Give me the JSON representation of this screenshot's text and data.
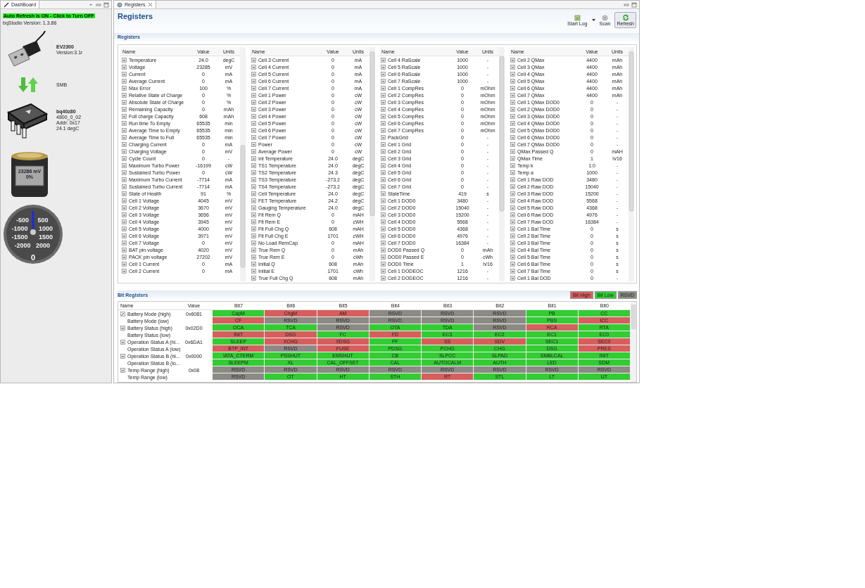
{
  "dashboard": {
    "tab": "DashBoard",
    "auto_refresh": "Auto Refresh is ON - Click to Turn OFF",
    "version": "bqStudio Version:  1.3.86",
    "adapter": {
      "name": "EV2300",
      "version": "Version:3.1r"
    },
    "bus": "SMB",
    "device": {
      "name": "bq40z80",
      "lines": [
        "4800_0_02",
        "Addr: 0x17",
        "24.1 degC"
      ]
    },
    "battery": {
      "voltage": "23286 mV",
      "charge": "0%"
    },
    "gauge": {
      "labels": [
        "-500",
        "500",
        "-1000",
        "1000",
        "-1500",
        "1500",
        "-2000",
        "2000"
      ],
      "reading": "0"
    }
  },
  "registers_view": {
    "tab": "Registers",
    "title": "Registers",
    "toolbar": [
      {
        "label": "Start Log",
        "kind": "log"
      },
      {
        "label": "Scan",
        "kind": "scan"
      },
      {
        "label": "Refresh",
        "kind": "refresh"
      }
    ],
    "section": "Registers",
    "tables": [
      {
        "columns": [
          "Name",
          "Value",
          "Units"
        ],
        "rows": [
          [
            "Temperature",
            "24.0",
            "degC"
          ],
          [
            "Voltage",
            "23285",
            "mV"
          ],
          [
            "Current",
            "0",
            "mA"
          ],
          [
            "Average Current",
            "0",
            "mA"
          ],
          [
            "Max Error",
            "100",
            "%"
          ],
          [
            "Relative State of Charge",
            "0",
            "%"
          ],
          [
            "Absolute State of Charge",
            "0",
            "%"
          ],
          [
            "Remaining Capacity",
            "0",
            "mAh"
          ],
          [
            "Full charge Capacity",
            "608",
            "mAh"
          ],
          [
            "Run time To Empty",
            "65535",
            "min"
          ],
          [
            "Average Time to Empty",
            "65535",
            "min"
          ],
          [
            "Average Time to Full",
            "65535",
            "min"
          ],
          [
            "Charging Current",
            "0",
            "mA"
          ],
          [
            "Charging Voltage",
            "0",
            "mV"
          ],
          [
            "Cycle Count",
            "0",
            "-"
          ],
          [
            "Maximum Turbo Power",
            "-16199",
            "cW"
          ],
          [
            "Sustained Turbo Power",
            "0",
            "cW"
          ],
          [
            "Maximum Turbo Current",
            "-7714",
            "mA"
          ],
          [
            "Sustained Turbo Current",
            "-7714",
            "mA"
          ],
          [
            "State of Health",
            "91",
            "%"
          ],
          [
            "Cell 1 Voltage",
            "4045",
            "mV"
          ],
          [
            "Cell 2 Voltage",
            "3670",
            "mV"
          ],
          [
            "Cell 3 Voltage",
            "3656",
            "mV"
          ],
          [
            "Cell 4 Voltage",
            "3945",
            "mV"
          ],
          [
            "Cell 5 Voltage",
            "4000",
            "mV"
          ],
          [
            "Cell 6 Voltage",
            "3971",
            "mV"
          ],
          [
            "Cell 7 Voltage",
            "0",
            "mV"
          ],
          [
            "BAT pin voltage",
            "4020",
            "mV"
          ],
          [
            "PACK pin voltage",
            "27202",
            "mV"
          ],
          [
            "Cell 1 Current",
            "0",
            "mA"
          ],
          [
            "Cell 2 Current",
            "0",
            "mA"
          ]
        ]
      },
      {
        "columns": [
          "Name",
          "Value",
          "Units"
        ],
        "rows": [
          [
            "Cell 3 Current",
            "0",
            "mA"
          ],
          [
            "Cell 4 Current",
            "0",
            "mA"
          ],
          [
            "Cell 5 Current",
            "0",
            "mA"
          ],
          [
            "Cell 6 Current",
            "0",
            "mA"
          ],
          [
            "Cell 7 Current",
            "0",
            "mA"
          ],
          [
            "Cell 1 Power",
            "0",
            "cW"
          ],
          [
            "Cell 2 Power",
            "0",
            "cW"
          ],
          [
            "Cell 3 Power",
            "0",
            "cW"
          ],
          [
            "Cell 4 Power",
            "0",
            "cW"
          ],
          [
            "Cell 5 Power",
            "0",
            "cW"
          ],
          [
            "Cell 6 Power",
            "0",
            "cW"
          ],
          [
            "Cell 7 Power",
            "0",
            "cW"
          ],
          [
            "Power",
            "0",
            "cW"
          ],
          [
            "Average Power",
            "0",
            "cW"
          ],
          [
            "Int Temperature",
            "24.0",
            "degC"
          ],
          [
            "TS1 Temperature",
            "24.0",
            "degC"
          ],
          [
            "TS2 Temperature",
            "24.3",
            "degC"
          ],
          [
            "TS3 Temperature",
            "-273.2",
            "degC"
          ],
          [
            "TS4 Temperature",
            "-273.2",
            "degC"
          ],
          [
            "Cell Temperature",
            "24.0",
            "degC"
          ],
          [
            "FET Temperature",
            "24.2",
            "degC"
          ],
          [
            "Gauging Temperature",
            "24.0",
            "degC"
          ],
          [
            "Flt Rem Q",
            "0",
            "mAH"
          ],
          [
            "Flt Rem E",
            "0",
            "cWH"
          ],
          [
            "Flt Full Chg Q",
            "608",
            "mAH"
          ],
          [
            "Flt Full Chg E",
            "1701",
            "cWH"
          ],
          [
            "No Load RemCap",
            "0",
            "mAH"
          ],
          [
            "True Rem Q",
            "0",
            "mAh"
          ],
          [
            "True Rem E",
            "0",
            "cWh"
          ],
          [
            "Initial Q",
            "608",
            "mAh"
          ],
          [
            "Initial E",
            "1701",
            "cWh"
          ],
          [
            "True Full Chg Q",
            "608",
            "mAh"
          ]
        ]
      },
      {
        "columns": [
          "Name",
          "Value",
          "Units"
        ],
        "rows": [
          [
            "Cell 4 RaScale",
            "1000",
            "-"
          ],
          [
            "Cell 5 RaScale",
            "1000",
            "-"
          ],
          [
            "Cell 6 RaScale",
            "1000",
            "-"
          ],
          [
            "Cell 7 RaScale",
            "1000",
            "-"
          ],
          [
            "Cell 1 CompRes",
            "0",
            "mOhm"
          ],
          [
            "Cell 2 CompRes",
            "0",
            "mOhm"
          ],
          [
            "Cell 3 CompRes",
            "0",
            "mOhm"
          ],
          [
            "Cell 4 CompRes",
            "0",
            "mOhm"
          ],
          [
            "Cell 5 CompRes",
            "0",
            "mOhm"
          ],
          [
            "Cell 6 CompRes",
            "0",
            "mOhm"
          ],
          [
            "Cell 7 CompRes",
            "0",
            "mOhm"
          ],
          [
            "PackGrid",
            "0",
            "-"
          ],
          [
            "Cell 1 Grid",
            "0",
            "-"
          ],
          [
            "Cell 2 Grid",
            "0",
            "-"
          ],
          [
            "Cell 3 Grid",
            "0",
            "-"
          ],
          [
            "Cell 4 Grid",
            "0",
            "-"
          ],
          [
            "Cell 5 Grid",
            "0",
            "-"
          ],
          [
            "Cell 6 Grid",
            "0",
            "-"
          ],
          [
            "Cell 7 Grid",
            "0",
            "-"
          ],
          [
            "StateTime",
            "419",
            "s"
          ],
          [
            "Cell 1 DOD0",
            "3480",
            "-"
          ],
          [
            "Cell 2 DOD0",
            "15040",
            "-"
          ],
          [
            "Cell 3 DOD0",
            "15200",
            "-"
          ],
          [
            "Cell 4 DOD0",
            "5568",
            "-"
          ],
          [
            "Cell 5 DOD0",
            "4368",
            "-"
          ],
          [
            "Cell 6 DOD0",
            "4976",
            "-"
          ],
          [
            "Cell 7 DOD0",
            "16384",
            "-"
          ],
          [
            "DOD0 Passed Q",
            "0",
            "mAh"
          ],
          [
            "DOD0 Passed E",
            "0",
            "cWh"
          ],
          [
            "DOD0 Time",
            "1",
            "h/16"
          ],
          [
            "Cell 1 DODEOC",
            "1216",
            "-"
          ],
          [
            "Cell 2 DODEOC",
            "1216",
            "-"
          ]
        ]
      },
      {
        "columns": [
          "Name",
          "Value",
          "Units"
        ],
        "rows": [
          [
            "Cell 2 QMax",
            "4400",
            "mAh"
          ],
          [
            "Cell 3 QMax",
            "4400",
            "mAh"
          ],
          [
            "Cell 4 QMax",
            "4400",
            "mAh"
          ],
          [
            "Cell 5 QMax",
            "4400",
            "mAh"
          ],
          [
            "Cell 6 QMax",
            "4400",
            "mAh"
          ],
          [
            "Cell 7 QMax",
            "4400",
            "mAh"
          ],
          [
            "Cell 1 QMax DOD0",
            "0",
            "-"
          ],
          [
            "Cell 2 QMax DOD0",
            "0",
            "-"
          ],
          [
            "Cell 3 QMax DOD0",
            "0",
            "-"
          ],
          [
            "Cell 4 QMax DOD0",
            "0",
            "-"
          ],
          [
            "Cell 5 QMax DOD0",
            "0",
            "-"
          ],
          [
            "Cell 6 QMax DOD0",
            "0",
            "-"
          ],
          [
            "Cell 7 QMax DOD0",
            "0",
            "-"
          ],
          [
            "QMax Passed Q",
            "0",
            "mAH"
          ],
          [
            "QMax Time",
            "1",
            "h/16"
          ],
          [
            "Temp k",
            "1.0",
            "-"
          ],
          [
            "Temp a",
            "1000",
            "-"
          ],
          [
            "Cell 1 Raw DOD",
            "3480",
            "-"
          ],
          [
            "Cell 2 Raw DOD",
            "15040",
            "-"
          ],
          [
            "Cell 3 Raw DOD",
            "15200",
            "-"
          ],
          [
            "Cell 4 Raw DOD",
            "5568",
            "-"
          ],
          [
            "Cell 5 Raw DOD",
            "4368",
            "-"
          ],
          [
            "Cell 6 Raw DOD",
            "4976",
            "-"
          ],
          [
            "Cell 7 Raw DOD",
            "16384",
            "-"
          ],
          [
            "Cell 1 Bal Time",
            "0",
            "s"
          ],
          [
            "Cell 2 Bal Time",
            "0",
            "s"
          ],
          [
            "Cell 3 Bal Time",
            "0",
            "s"
          ],
          [
            "Cell 4 Bal Time",
            "0",
            "s"
          ],
          [
            "Cell 5 Bal Time",
            "0",
            "s"
          ],
          [
            "Cell 6 Bal Time",
            "0",
            "s"
          ],
          [
            "Cell 7 Bal Time",
            "0",
            "s"
          ],
          [
            "Cell 1 Bal DOD",
            "0",
            "-"
          ]
        ]
      }
    ]
  },
  "bit_registers": {
    "title": "Bit Registers",
    "legend": [
      {
        "label": "Bit High",
        "color": "#d65f5d"
      },
      {
        "label": "Bit Low",
        "color": "#33cc33"
      },
      {
        "label": "RSVD",
        "color": "#8c8a84"
      }
    ],
    "columns": [
      "Name",
      "Value",
      "Bit7",
      "Bit6",
      "Bit5",
      "Bit4",
      "Bit3",
      "Bit2",
      "Bit1",
      "Bit0"
    ],
    "rows": [
      {
        "name": "Battery Mode (high)",
        "value": "0x6081",
        "kind": "editable",
        "bits": [
          {
            "label": "CapM",
            "color": "#33cc33"
          },
          {
            "label": "ChgM",
            "color": "#d65f5d"
          },
          {
            "label": "AM",
            "color": "#d65f5d"
          },
          {
            "label": "RSVD",
            "color": "#8c8a84"
          },
          {
            "label": "RSVD",
            "color": "#8c8a84"
          },
          {
            "label": "RSVD",
            "color": "#8c8a84"
          },
          {
            "label": "PB",
            "color": "#33cc33"
          },
          {
            "label": "CC",
            "color": "#33cc33"
          }
        ]
      },
      {
        "name": "Battery Mode (low)",
        "kind": "subrow",
        "bits": [
          {
            "label": "CF",
            "color": "#d65f5d"
          },
          {
            "label": "RSVD",
            "color": "#8c8a84"
          },
          {
            "label": "RSVD",
            "color": "#8c8a84"
          },
          {
            "label": "RSVD",
            "color": "#8c8a84"
          },
          {
            "label": "RSVD",
            "color": "#8c8a84"
          },
          {
            "label": "RSVD",
            "color": "#8c8a84"
          },
          {
            "label": "PBS",
            "color": "#33cc33"
          },
          {
            "label": "ICC",
            "color": "#d65f5d"
          }
        ]
      },
      {
        "name": "Battery Status (high)",
        "value": "0x02D0",
        "kind": "register",
        "bits": [
          {
            "label": "OCA",
            "color": "#33cc33"
          },
          {
            "label": "TCA",
            "color": "#33cc33"
          },
          {
            "label": "RSVD",
            "color": "#8c8a84"
          },
          {
            "label": "OTA",
            "color": "#33cc33"
          },
          {
            "label": "TDA",
            "color": "#33cc33"
          },
          {
            "label": "RSVD",
            "color": "#8c8a84"
          },
          {
            "label": "RCA",
            "color": "#d65f5d"
          },
          {
            "label": "RTA",
            "color": "#33cc33"
          }
        ]
      },
      {
        "name": "Battery Status (low)",
        "kind": "subrow",
        "bits": [
          {
            "label": "INIT",
            "color": "#d65f5d"
          },
          {
            "label": "DSG",
            "color": "#d65f5d"
          },
          {
            "label": "FC",
            "color": "#33cc33"
          },
          {
            "label": "FD",
            "color": "#d65f5d"
          },
          {
            "label": "EC3",
            "color": "#33cc33"
          },
          {
            "label": "EC2",
            "color": "#33cc33"
          },
          {
            "label": "EC1",
            "color": "#33cc33"
          },
          {
            "label": "EC0",
            "color": "#33cc33"
          }
        ]
      },
      {
        "name": "Operation Status A (hi...",
        "value": "0x6DA1",
        "kind": "register",
        "bits": [
          {
            "label": "SLEEP",
            "color": "#33cc33"
          },
          {
            "label": "XCHG",
            "color": "#d65f5d"
          },
          {
            "label": "XDSG",
            "color": "#d65f5d"
          },
          {
            "label": "PF",
            "color": "#33cc33"
          },
          {
            "label": "SS",
            "color": "#d65f5d"
          },
          {
            "label": "SDV",
            "color": "#d65f5d"
          },
          {
            "label": "SEC1",
            "color": "#33cc33"
          },
          {
            "label": "SEC0",
            "color": "#d65f5d"
          }
        ]
      },
      {
        "name": "Operation Status A (low)",
        "kind": "subrow",
        "bits": [
          {
            "label": "BTP_INT",
            "color": "#d65f5d"
          },
          {
            "label": "RSVD",
            "color": "#8c8a84"
          },
          {
            "label": "FUSE",
            "color": "#d65f5d"
          },
          {
            "label": "PDSG",
            "color": "#33cc33"
          },
          {
            "label": "PCHG",
            "color": "#33cc33"
          },
          {
            "label": "CHG",
            "color": "#33cc33"
          },
          {
            "label": "DSG",
            "color": "#33cc33"
          },
          {
            "label": "PRES",
            "color": "#d65f5d"
          }
        ]
      },
      {
        "name": "Operation Status B (hi...",
        "value": "0x0000",
        "kind": "register",
        "bits": [
          {
            "label": "IATA_CTERM",
            "color": "#33cc33"
          },
          {
            "label": "PSSHUT",
            "color": "#33cc33"
          },
          {
            "label": "EMSHUT",
            "color": "#33cc33"
          },
          {
            "label": "CB",
            "color": "#33cc33"
          },
          {
            "label": "SLPCC",
            "color": "#33cc33"
          },
          {
            "label": "SLPAD",
            "color": "#33cc33"
          },
          {
            "label": "SMBLCAL",
            "color": "#33cc33"
          },
          {
            "label": "INIT",
            "color": "#33cc33"
          }
        ]
      },
      {
        "name": "Operation Status B (lo...",
        "kind": "subrow",
        "bits": [
          {
            "label": "SLEEPM",
            "color": "#33cc33"
          },
          {
            "label": "XL",
            "color": "#33cc33"
          },
          {
            "label": "CAL_OFFSET",
            "color": "#33cc33"
          },
          {
            "label": "CAL",
            "color": "#33cc33"
          },
          {
            "label": "AUTOCALM",
            "color": "#33cc33"
          },
          {
            "label": "AUTH",
            "color": "#33cc33"
          },
          {
            "label": "LED",
            "color": "#33cc33"
          },
          {
            "label": "SDM",
            "color": "#33cc33"
          }
        ]
      },
      {
        "name": "Temp Range (high)",
        "value": "0x08",
        "kind": "register",
        "bits": [
          {
            "label": "RSVD",
            "color": "#8c8a84"
          },
          {
            "label": "RSVD",
            "color": "#8c8a84"
          },
          {
            "label": "RSVD",
            "color": "#8c8a84"
          },
          {
            "label": "RSVD",
            "color": "#8c8a84"
          },
          {
            "label": "RSVD",
            "color": "#8c8a84"
          },
          {
            "label": "RSVD",
            "color": "#8c8a84"
          },
          {
            "label": "RSVD",
            "color": "#8c8a84"
          },
          {
            "label": "RSVD",
            "color": "#8c8a84"
          }
        ]
      },
      {
        "name": "Temp Range (low)",
        "kind": "subrow",
        "bits": [
          {
            "label": "RSVD",
            "color": "#8c8a84"
          },
          {
            "label": "OT",
            "color": "#33cc33"
          },
          {
            "label": "HT",
            "color": "#33cc33"
          },
          {
            "label": "STH",
            "color": "#33cc33"
          },
          {
            "label": "RT",
            "color": "#d65f5d"
          },
          {
            "label": "STL",
            "color": "#33cc33"
          },
          {
            "label": "LT",
            "color": "#33cc33"
          },
          {
            "label": "UT",
            "color": "#33cc33"
          }
        ]
      }
    ]
  }
}
